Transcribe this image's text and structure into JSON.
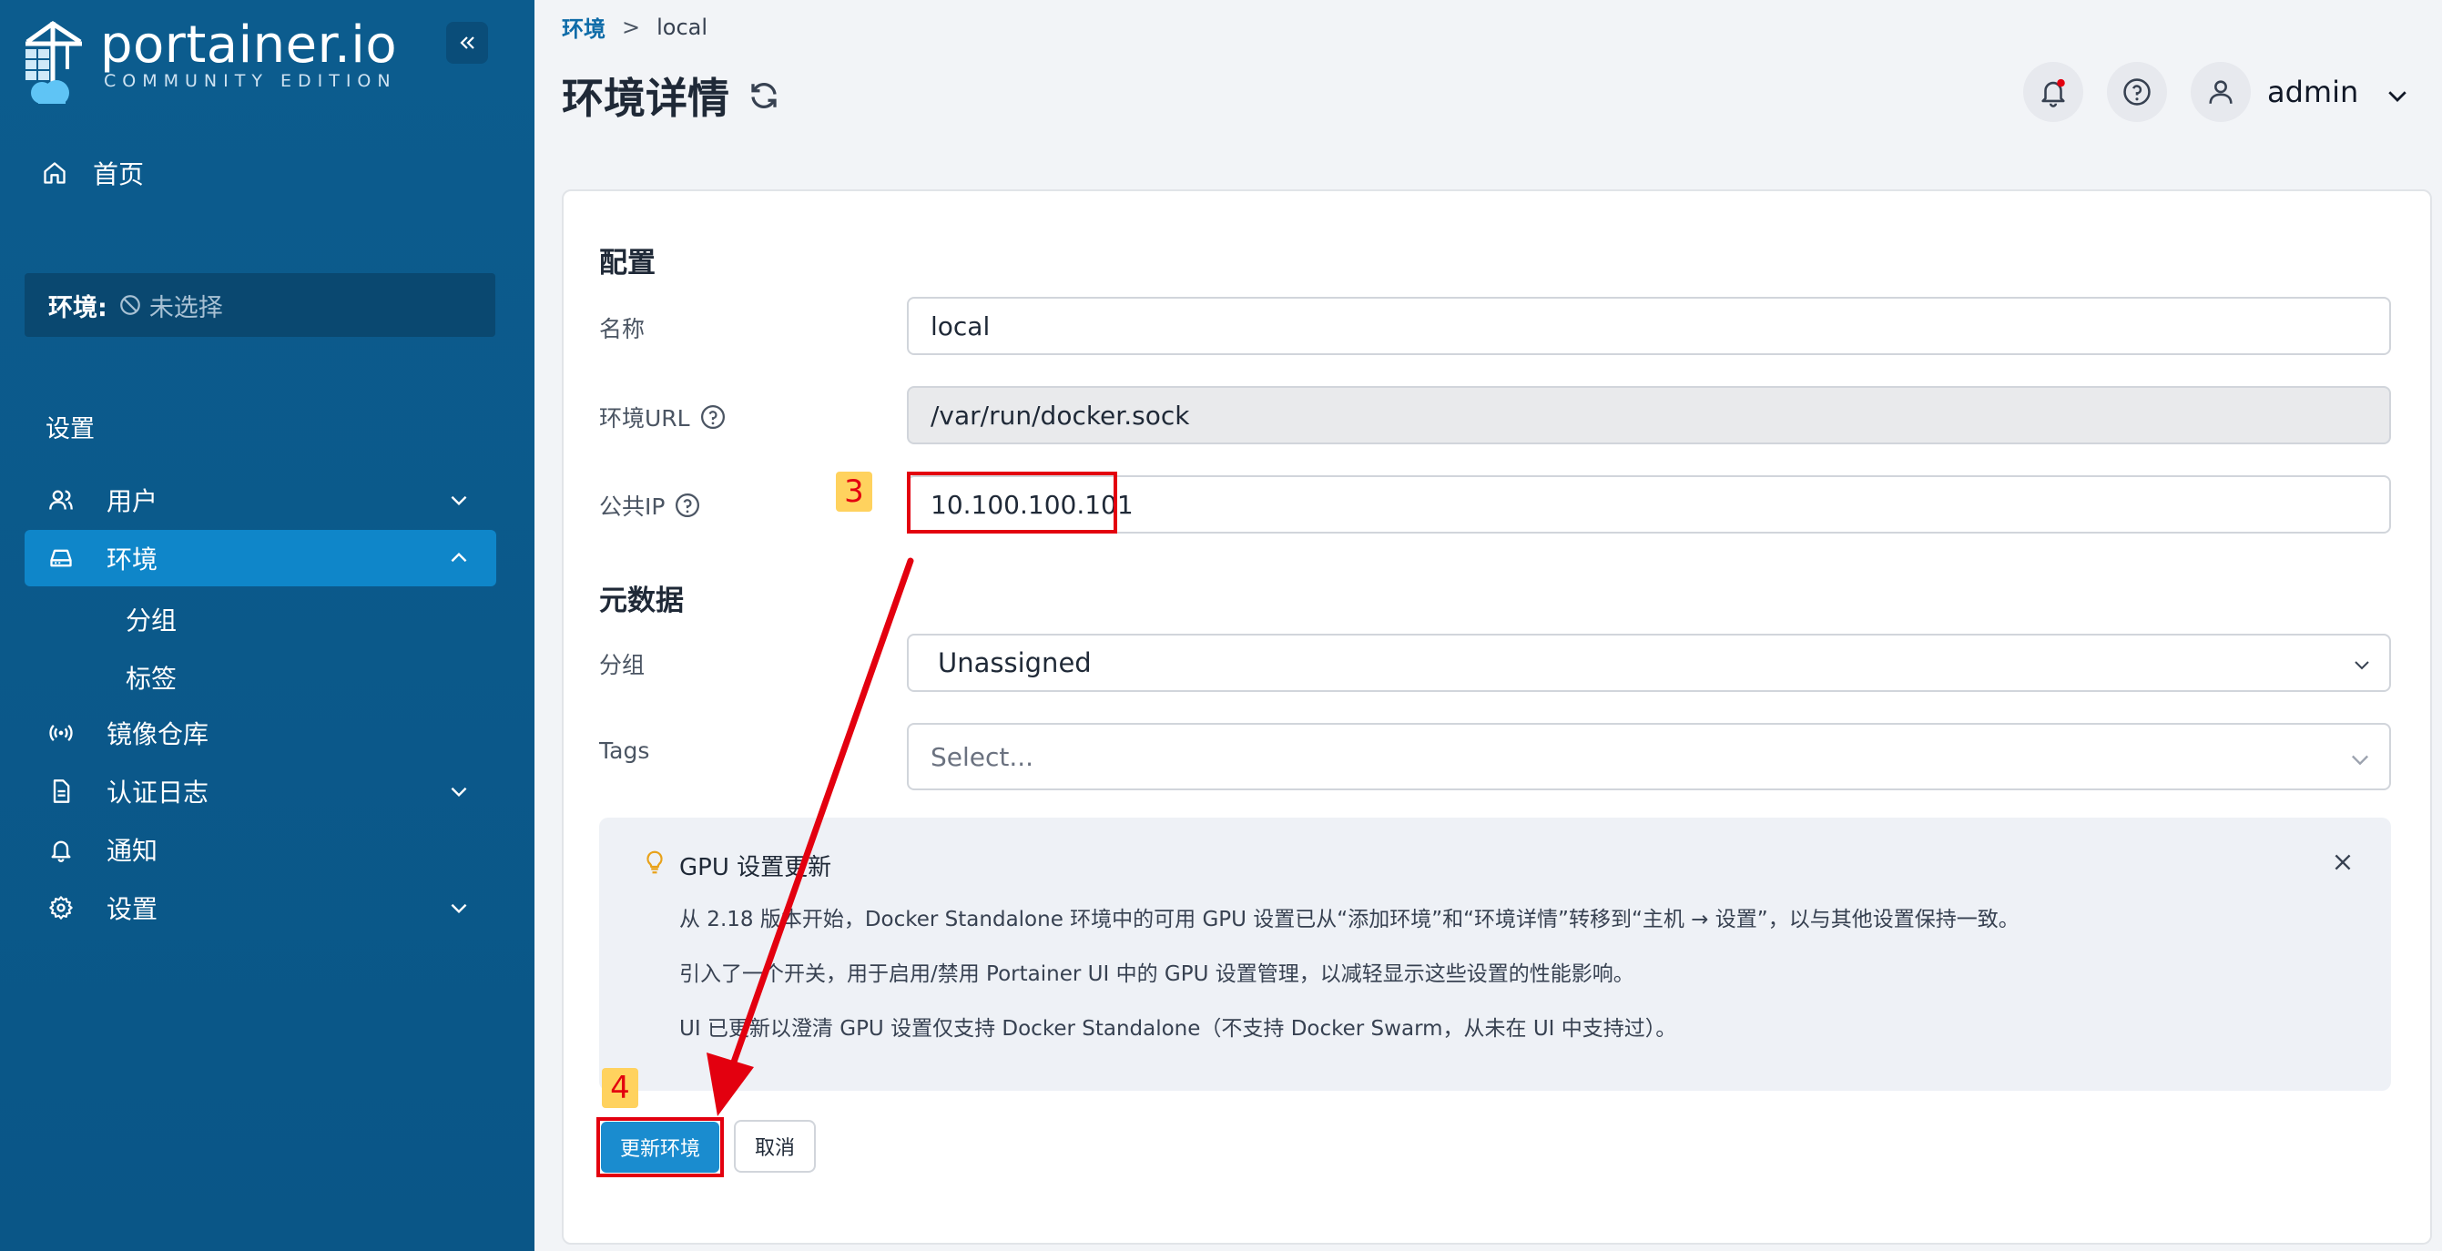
{
  "sidebar": {
    "logo_title": "portainer.io",
    "logo_subtitle": "COMMUNITY EDITION",
    "home_label": "首页",
    "env_key": "环境:",
    "env_value": "未选择",
    "section_label": "设置",
    "items": [
      {
        "label": "用户",
        "icon": "users-icon"
      },
      {
        "label": "环境",
        "icon": "drive-icon"
      },
      {
        "label": "分组"
      },
      {
        "label": "标签"
      },
      {
        "label": "镜像仓库",
        "icon": "radio-icon"
      },
      {
        "label": "认证日志",
        "icon": "file-icon"
      },
      {
        "label": "通知",
        "icon": "bell-icon"
      },
      {
        "label": "设置",
        "icon": "gear-icon"
      }
    ]
  },
  "breadcrumb": {
    "link": "环境",
    "sep": ">",
    "current": "local"
  },
  "page_title": "环境详情",
  "header": {
    "user": "admin"
  },
  "form": {
    "section_config": "配置",
    "name_label": "名称",
    "name_value": "local",
    "url_label": "环境URL",
    "url_value": "/var/run/docker.sock",
    "public_ip_label": "公共IP",
    "public_ip_value": "10.100.100.101",
    "section_meta": "元数据",
    "group_label": "分组",
    "group_value": "Unassigned",
    "tags_label": "Tags",
    "tags_placeholder": "Select..."
  },
  "notice": {
    "title": "GPU 设置更新",
    "line1": "从 2.18 版本开始，Docker Standalone 环境中的可用 GPU 设置已从“添加环境”和“环境详情”转移到“主机 → 设置”，以与其他设置保持一致。",
    "line2": "引入了一个开关，用于启用/禁用 Portainer UI 中的 GPU 设置管理，以减轻显示这些设置的性能影响。",
    "line3": "UI 已更新以澄清 GPU 设置仅支持 Docker Standalone（不支持 Docker Swarm，从未在 UI 中支持过）。"
  },
  "buttons": {
    "update": "更新环境",
    "cancel": "取消"
  },
  "annotations": {
    "step3": "3",
    "step4": "4"
  },
  "colors": {
    "sidebar": "#0c5c8e",
    "active": "#0f86c9",
    "primary": "#1a8ccf",
    "highlight": "#e3000f",
    "badge": "#ffd25e"
  }
}
